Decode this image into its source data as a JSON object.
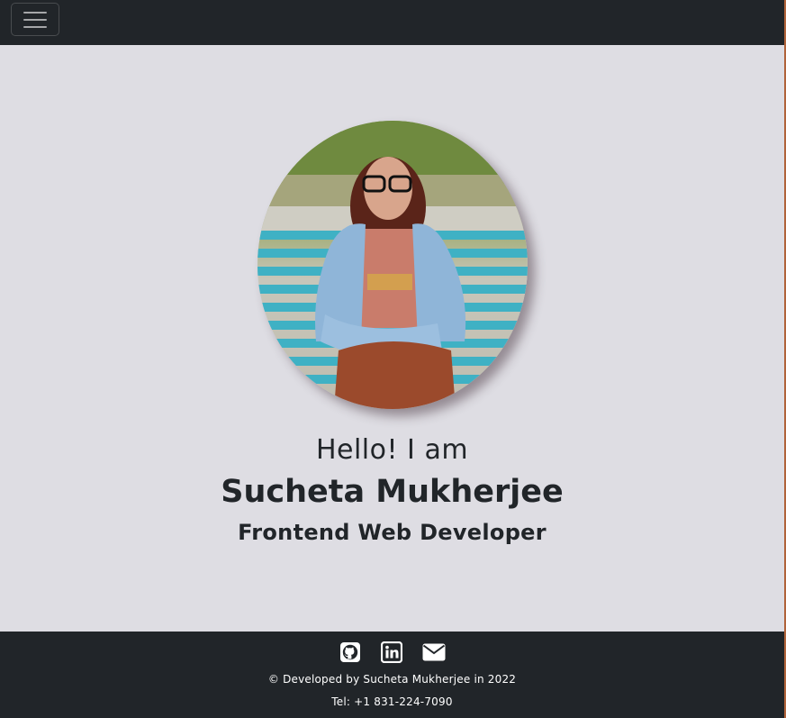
{
  "navbar": {
    "toggle_icon": "hamburger-menu-icon"
  },
  "hero": {
    "profile_photo": "profile-photo",
    "greeting": "Hello! I am",
    "name": "Sucheta Mukherjee",
    "role": "Frontend Web Developer"
  },
  "footer": {
    "social_icons": [
      "github-icon",
      "linkedin-icon",
      "envelope-icon"
    ],
    "credit": "© Developed by Sucheta Mukherjee in 2022",
    "tel": "Tel: +1 831-224-7090"
  },
  "colors": {
    "navbar_bg": "#212529",
    "page_bg": "#dedde3",
    "footer_bg": "#212529",
    "text": "#212529"
  }
}
